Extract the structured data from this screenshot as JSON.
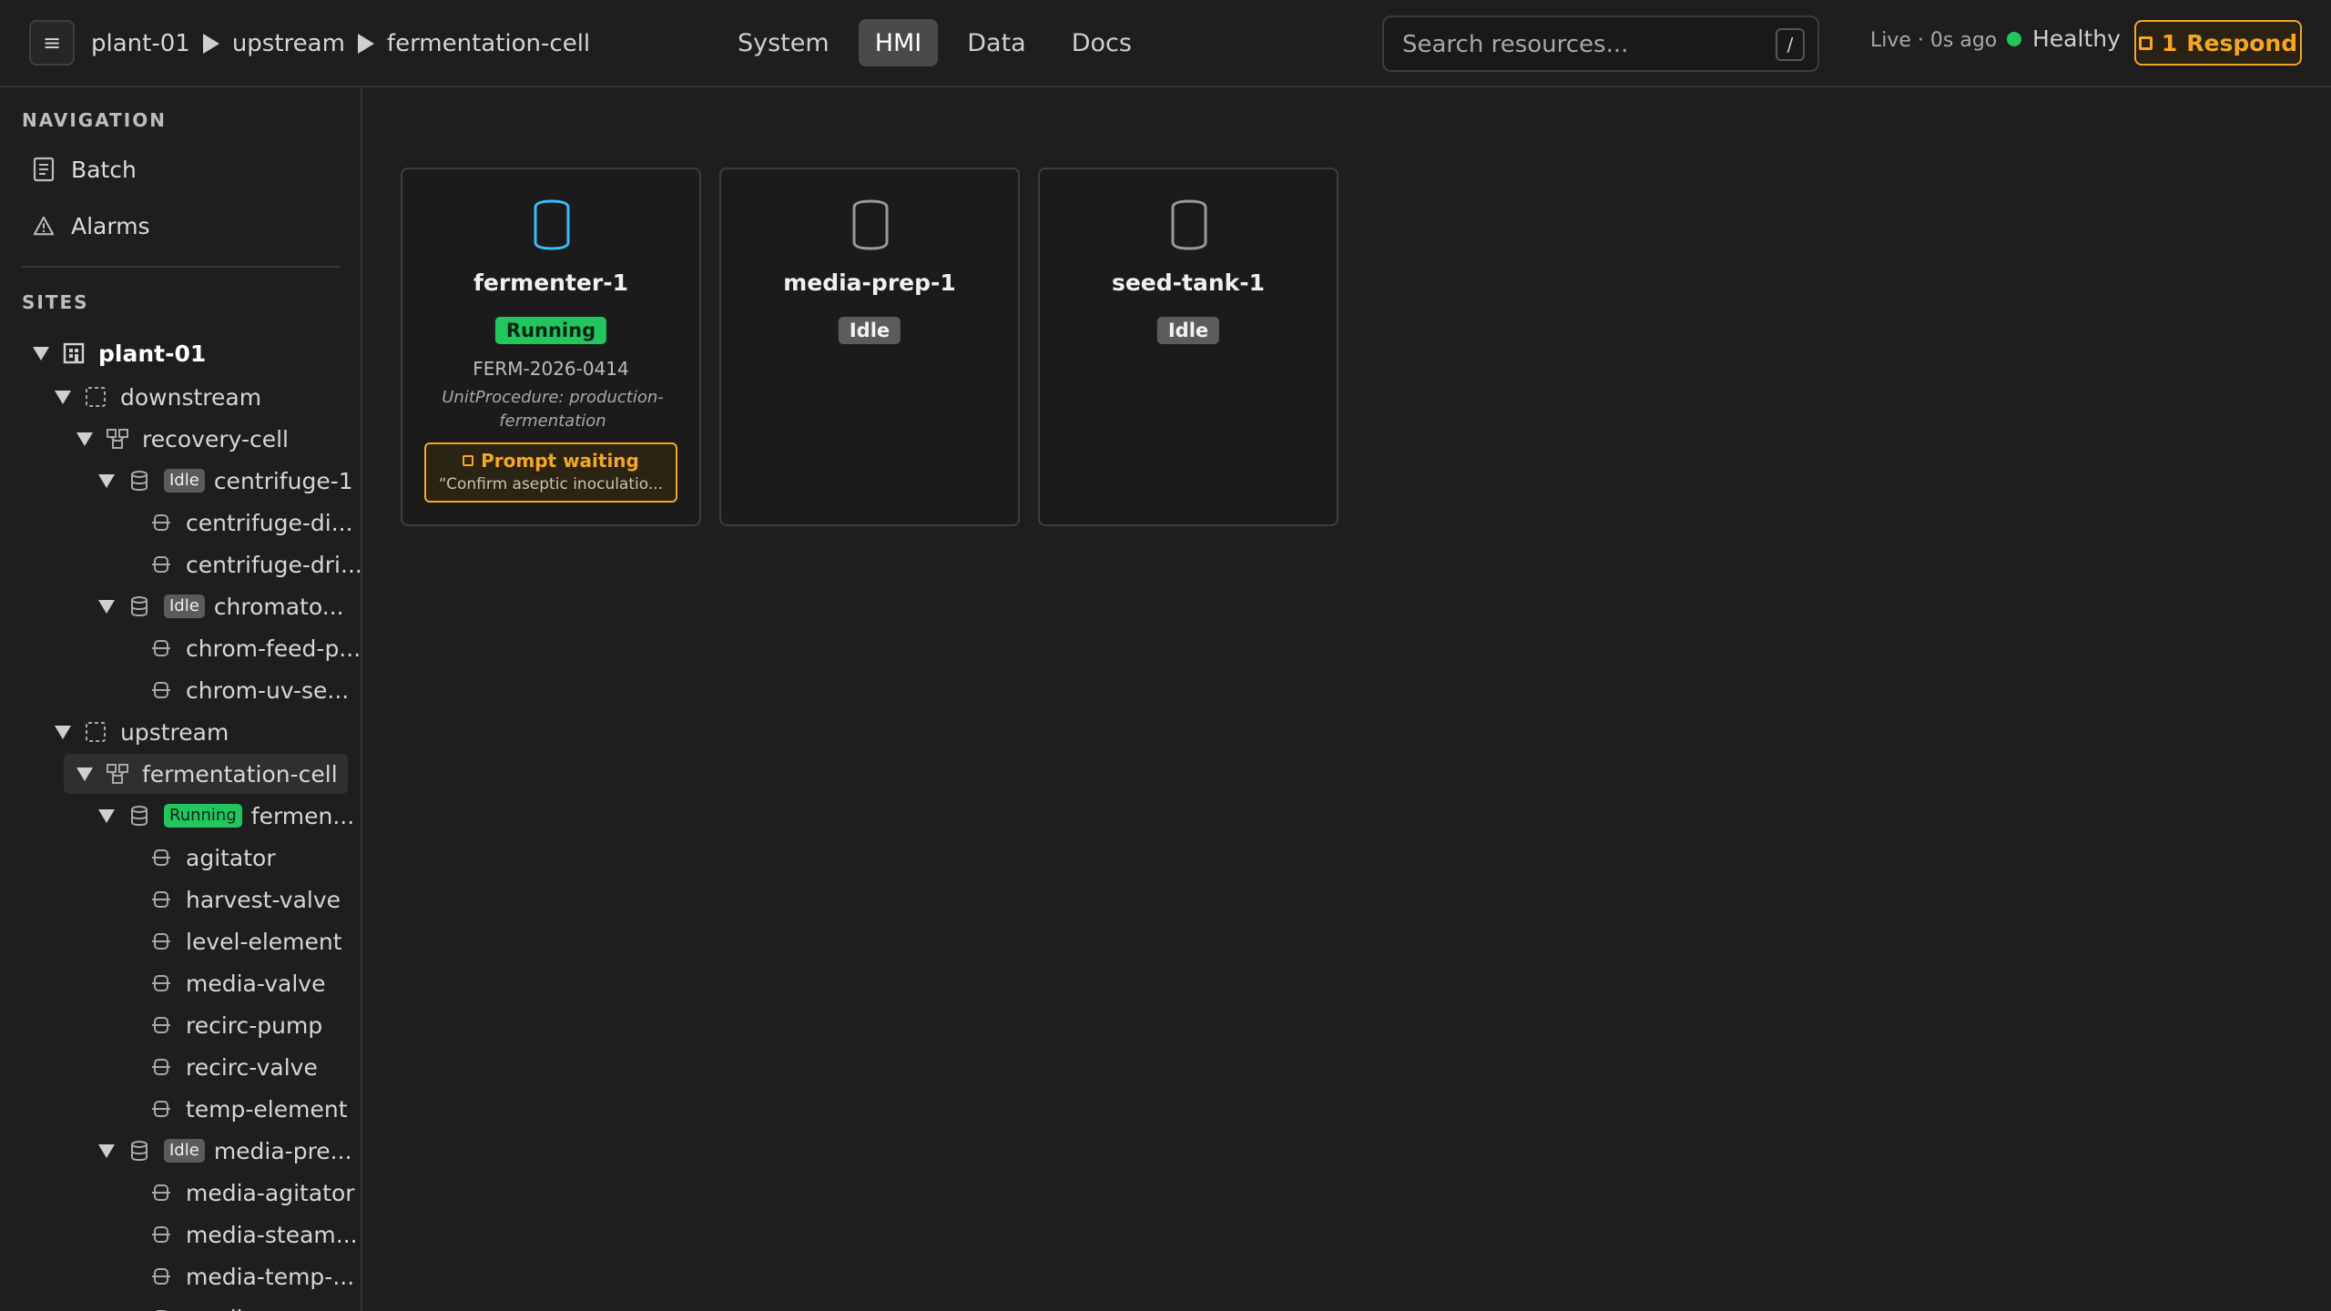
{
  "header": {
    "menu_icon": "hamburger-icon",
    "breadcrumb": [
      "plant-01",
      "upstream",
      "fermentation-cell"
    ],
    "tabs": [
      "System",
      "HMI",
      "Data",
      "Docs"
    ],
    "active_tab": "HMI",
    "search_placeholder": "Search resources...",
    "search_shortcut": "/",
    "live_status": "Live · 0s ago",
    "health": "Healthy",
    "health_color": "#22c55e",
    "respond_count": "1",
    "respond_label": "Respond",
    "accent_color": "#f5a623"
  },
  "sidebar": {
    "navigation_title": "NAVIGATION",
    "nav_items": [
      {
        "label": "Batch",
        "icon": "batch-record-icon"
      },
      {
        "label": "Alarms",
        "icon": "alarm-triangle-icon"
      }
    ],
    "sites_title": "SITES",
    "tree": [
      {
        "label": "plant-01",
        "icon": "site-building-icon",
        "expanded": true
      },
      {
        "label": "downstream",
        "icon": "area-icon",
        "expanded": true
      },
      {
        "label": "recovery-cell",
        "icon": "process-cell-icon",
        "expanded": true
      },
      {
        "label": "centrifuge-1",
        "icon": "unit-icon",
        "status": "Idle",
        "expanded": true
      },
      {
        "label": "centrifuge-di...",
        "icon": "equipment-module-icon"
      },
      {
        "label": "centrifuge-dri...",
        "icon": "equipment-module-icon"
      },
      {
        "label": "chromato...",
        "icon": "unit-icon",
        "status": "Idle",
        "expanded": true
      },
      {
        "label": "chrom-feed-p...",
        "icon": "equipment-module-icon"
      },
      {
        "label": "chrom-uv-se...",
        "icon": "equipment-module-icon"
      },
      {
        "label": "upstream",
        "icon": "area-icon",
        "expanded": true
      },
      {
        "label": "fermentation-cell",
        "icon": "process-cell-icon",
        "expanded": true,
        "selected": true
      },
      {
        "label": "fermen...",
        "icon": "unit-icon",
        "status": "Running",
        "expanded": true
      },
      {
        "label": "agitator",
        "icon": "equipment-module-icon"
      },
      {
        "label": "harvest-valve",
        "icon": "equipment-module-icon"
      },
      {
        "label": "level-element",
        "icon": "equipment-module-icon"
      },
      {
        "label": "media-valve",
        "icon": "equipment-module-icon"
      },
      {
        "label": "recirc-pump",
        "icon": "equipment-module-icon"
      },
      {
        "label": "recirc-valve",
        "icon": "equipment-module-icon"
      },
      {
        "label": "temp-element",
        "icon": "equipment-module-icon"
      },
      {
        "label": "media-pre...",
        "icon": "unit-icon",
        "status": "Idle",
        "expanded": true
      },
      {
        "label": "media-agitator",
        "icon": "equipment-module-icon"
      },
      {
        "label": "media-steam...",
        "icon": "equipment-module-icon"
      },
      {
        "label": "media-temp-...",
        "icon": "equipment-module-icon"
      },
      {
        "label": "media-...",
        "icon": "equipment-module-icon"
      }
    ]
  },
  "cards": [
    {
      "name": "fermenter-1",
      "status": "Running",
      "icon_color": "#38bdf8",
      "batch_id": "FERM-2026-0414",
      "procedure": "UnitProcedure: production-fermentation",
      "prompt_title": "Prompt waiting",
      "prompt_text": "“Confirm aseptic inoculatio..."
    },
    {
      "name": "media-prep-1",
      "status": "Idle",
      "icon_color": "#9a9a9a"
    },
    {
      "name": "seed-tank-1",
      "status": "Idle",
      "icon_color": "#9a9a9a"
    }
  ]
}
